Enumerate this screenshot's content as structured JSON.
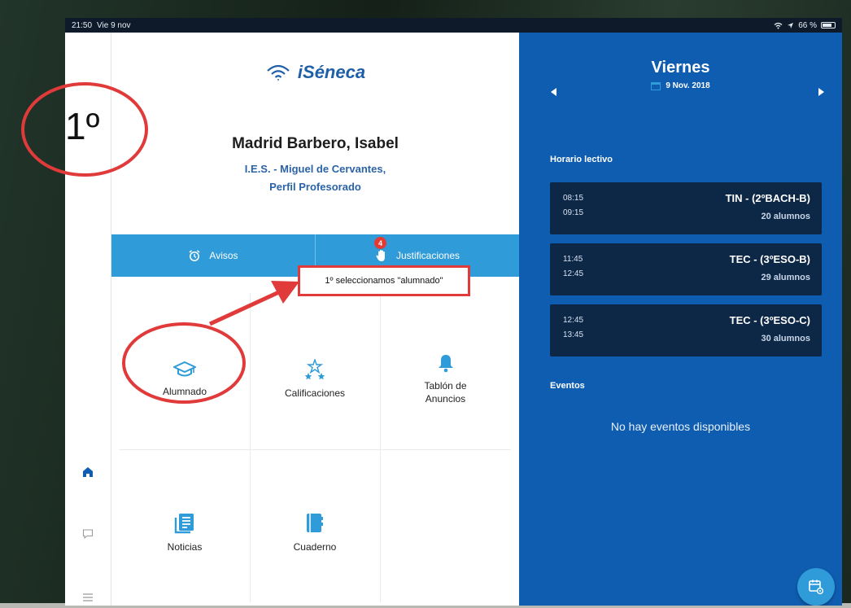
{
  "status_bar": {
    "time": "21:50",
    "date": "Vie 9 nov",
    "battery": "66 %"
  },
  "app": {
    "logo_text": "iSéneca"
  },
  "user": {
    "name": "Madrid Barbero, Isabel",
    "school": "I.E.S. - Miguel de Cervantes,",
    "profile": "Perfil Profesorado"
  },
  "tabs": {
    "avisos": {
      "label": "Avisos"
    },
    "justificaciones": {
      "label": "Justificaciones",
      "badge": "4"
    }
  },
  "tiles": {
    "alumnado": "Alumnado",
    "calificaciones": "Calificaciones",
    "tablon_line1": "Tablón de",
    "tablon_line2": "Anuncios",
    "noticias": "Noticias",
    "cuaderno": "Cuaderno"
  },
  "annotation": {
    "step_number": "1º",
    "callout_text": "1º seleccionamos \"alumnado\"",
    "color": "#e03a3a"
  },
  "schedule": {
    "day": "Viernes",
    "date": "9 Nov. 2018",
    "section_title": "Horario lectivo",
    "classes": [
      {
        "start": "08:15",
        "end": "09:15",
        "subject": "TIN - (2ºBACH-B)",
        "students": "20 alumnos"
      },
      {
        "start": "11:45",
        "end": "12:45",
        "subject": "TEC - (3ºESO-B)",
        "students": "29 alumnos"
      },
      {
        "start": "12:45",
        "end": "13:45",
        "subject": "TEC - (3ºESO-C)",
        "students": "30 alumnos"
      }
    ],
    "events_title": "Eventos",
    "no_events": "No hay eventos disponibles"
  },
  "colors": {
    "brand_blue": "#0f5db1",
    "tab_blue": "#2f9bd8",
    "card_navy": "#0d2747",
    "logo_blue": "#1f5fa8"
  },
  "icons": {
    "home": "home-icon",
    "chat": "chat-bubble-icon",
    "menu": "hamburger-menu-icon",
    "alarm": "alarm-clock-icon",
    "hand": "raised-hand-icon",
    "graduation": "graduation-cap-icon",
    "stars": "stars-icon",
    "bell": "bell-icon",
    "news": "newspaper-icon",
    "notebook": "notebook-icon",
    "calendar": "calendar-icon",
    "fab": "calendar-settings-icon"
  }
}
